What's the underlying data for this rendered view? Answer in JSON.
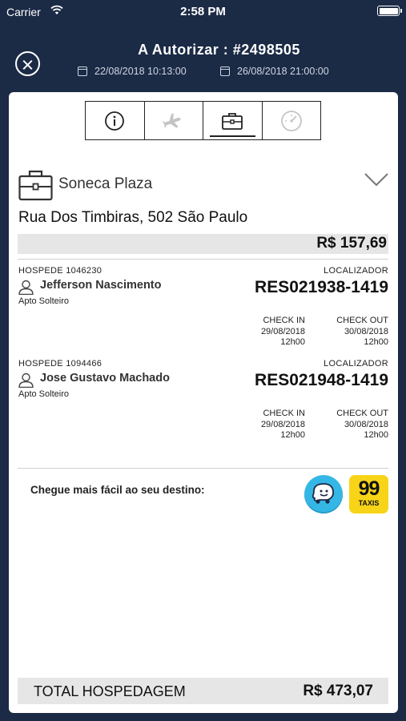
{
  "status_bar": {
    "carrier": "Carrier",
    "time": "2:58 PM"
  },
  "header": {
    "title": "A Autorizar : #2498505",
    "start_date": "22/08/2018 10:13:00",
    "end_date": "26/08/2018 21:00:00"
  },
  "tabs": [
    {
      "icon": "info-icon",
      "active": false
    },
    {
      "icon": "airplane-icon",
      "active": false
    },
    {
      "icon": "briefcase-icon",
      "active": true
    },
    {
      "icon": "speedometer-icon",
      "active": false
    }
  ],
  "hotel": {
    "name": "Soneca Plaza",
    "address": "Rua Dos Timbiras, 502 São Paulo",
    "price": "R$ 157,69"
  },
  "guests": [
    {
      "label": "HOSPEDE 1046230",
      "name": "Jefferson Nascimento",
      "room": "Apto Solteiro",
      "locator_label": "LOCALIZADOR",
      "locator": "RES021938-1419",
      "checkin_label": "CHECK IN",
      "checkin_date": "29/08/2018",
      "checkin_time": "12h00",
      "checkout_label": "CHECK OUT",
      "checkout_date": "30/08/2018",
      "checkout_time": "12h00"
    },
    {
      "label": "HOSPEDE 1094466",
      "name": "Jose Gustavo Machado",
      "room": "Apto Solteiro",
      "locator_label": "LOCALIZADOR",
      "locator": "RES021948-1419",
      "checkin_label": "CHECK IN",
      "checkin_date": "29/08/2018",
      "checkin_time": "12h00",
      "checkout_label": "CHECK OUT",
      "checkout_date": "30/08/2018",
      "checkout_time": "12h00"
    }
  ],
  "route": {
    "label": "Chegue mais fácil ao seu destino:",
    "taxi_number": "99",
    "taxi_label": "TAXIS"
  },
  "total": {
    "label": "TOTAL HOSPEDAGEM",
    "value": "R$ 473,07"
  },
  "colors": {
    "background": "#1b2a45",
    "waze": "#35b7e6",
    "taxi": "#f7d417",
    "bar": "#e6e6e6"
  }
}
